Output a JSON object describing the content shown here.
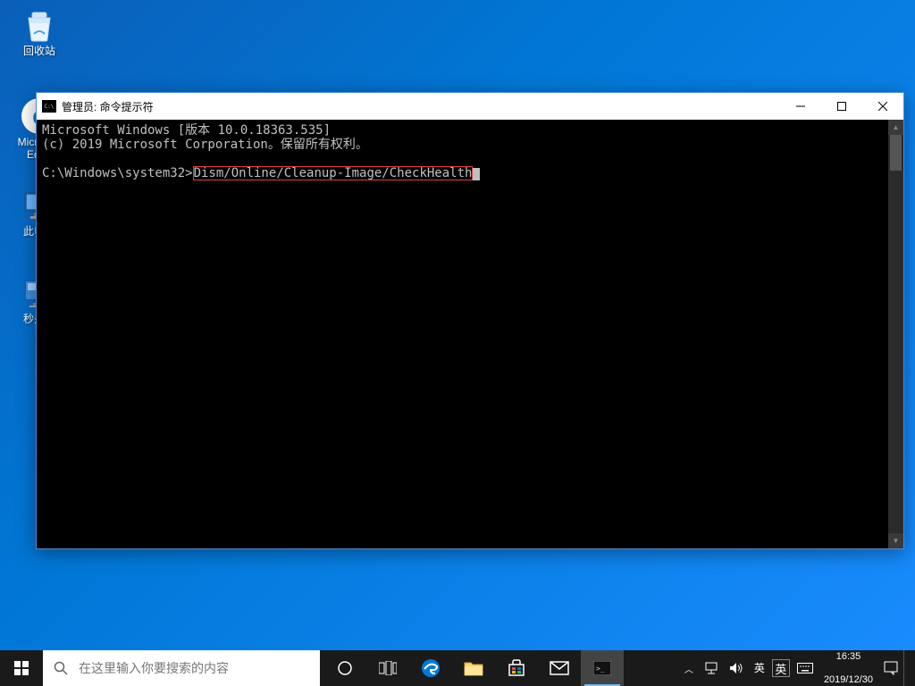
{
  "desktop": {
    "recycle_bin": "回收站",
    "edge": "Microsoft Edge",
    "this_pc": "此电脑",
    "shutdown": "秒关机"
  },
  "window": {
    "title": "管理员: 命令提示符",
    "lines": {
      "banner": "Microsoft Windows [版本 10.0.18363.535]",
      "copyright": "(c) 2019 Microsoft Corporation。保留所有权利。",
      "prompt": "C:\\Windows\\system32>",
      "command": "Dism/Online/Cleanup-Image/CheckHealth"
    }
  },
  "taskbar": {
    "search_placeholder": "在这里输入你要搜索的内容",
    "ime_lang": "英",
    "ime_mode": "英",
    "kbd": "⌨",
    "time": "16:35",
    "date": "2019/12/30"
  }
}
